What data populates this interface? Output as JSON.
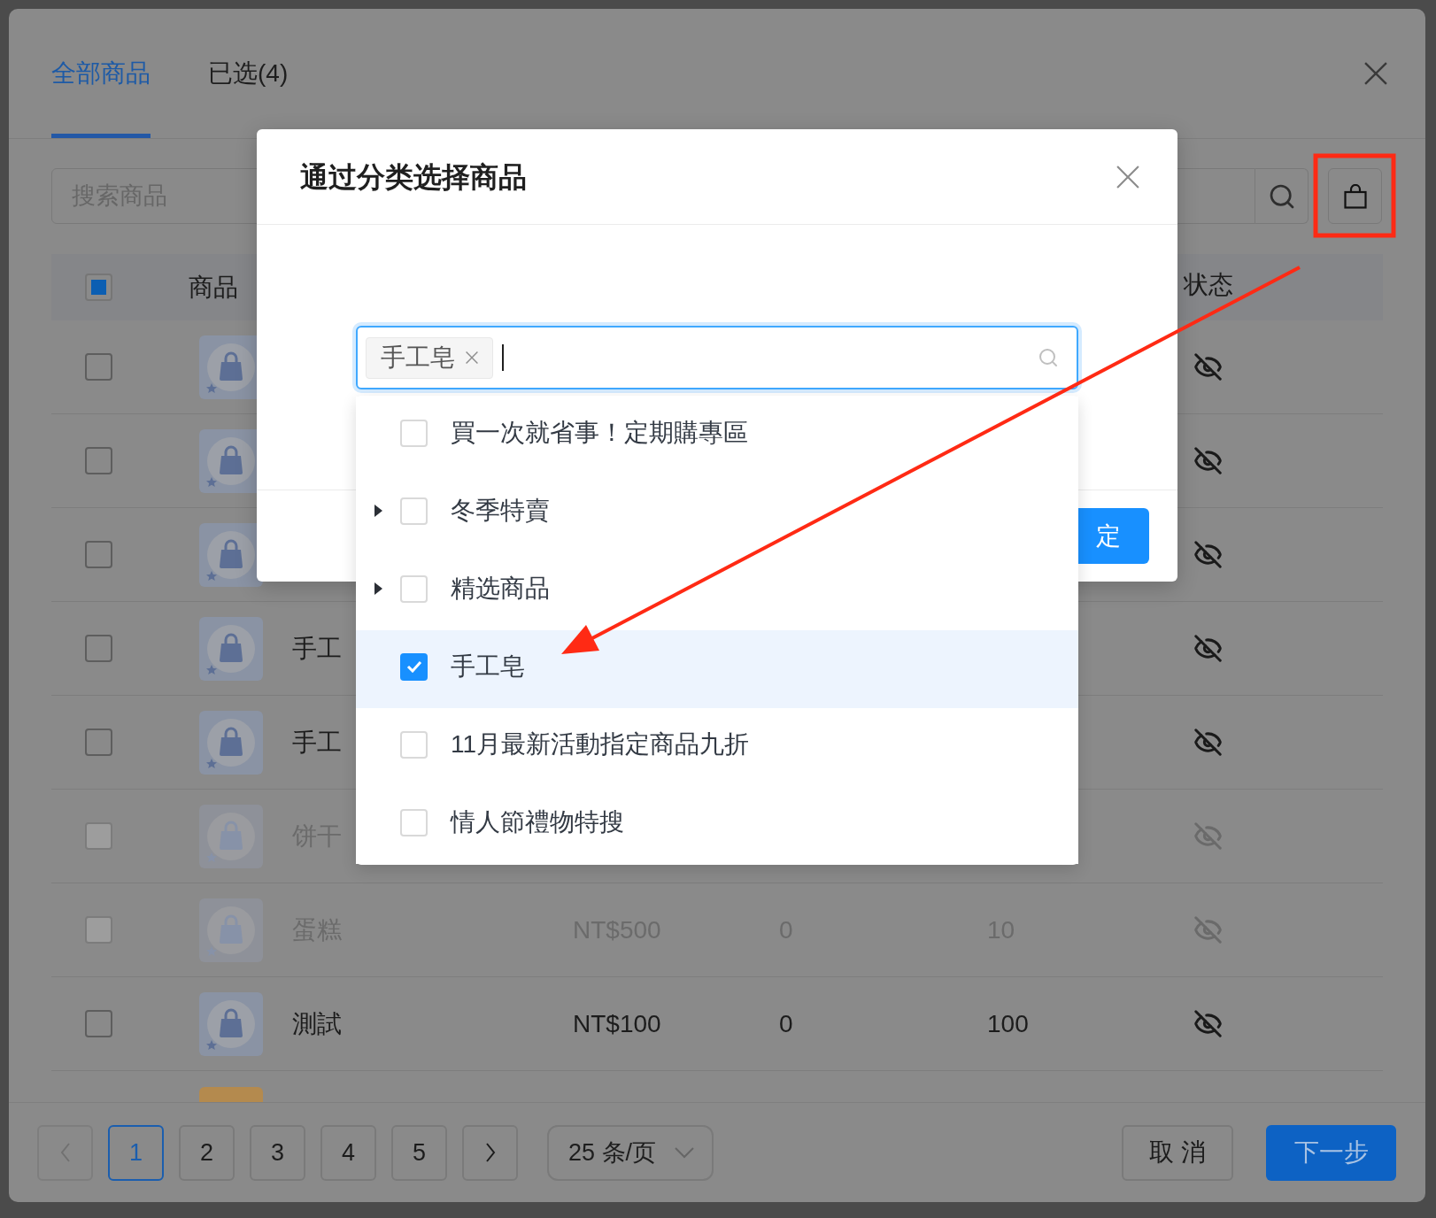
{
  "main_modal": {
    "tabs": [
      {
        "label": "全部商品",
        "selected": true
      },
      {
        "label": "已选(4)",
        "selected": false
      }
    ],
    "search": {
      "placeholder": "搜索商品"
    },
    "table": {
      "select_all": {
        "indeterminate": true
      },
      "columns": {
        "product": "商品",
        "status": "状态"
      },
      "rows": [
        {
          "kind": "bag",
          "checked": false,
          "disabled": false,
          "visible": false
        },
        {
          "kind": "bag",
          "checked": false,
          "disabled": false,
          "visible": false
        },
        {
          "kind": "bag",
          "checked": false,
          "disabled": false,
          "visible": false
        },
        {
          "kind": "bag",
          "checked": false,
          "disabled": false,
          "name": "手工",
          "visible": false
        },
        {
          "kind": "bag",
          "checked": false,
          "disabled": false,
          "name": "手工",
          "visible": false
        },
        {
          "kind": "bag",
          "checked": false,
          "disabled": true,
          "name": "饼干",
          "visible": false
        },
        {
          "kind": "bag",
          "checked": false,
          "disabled": true,
          "name": "蛋糕",
          "cells": [
            "NT$500",
            "0",
            "10"
          ],
          "visible": false
        },
        {
          "kind": "bag",
          "checked": false,
          "disabled": false,
          "name": "測試",
          "cells": [
            "NT$100",
            "0",
            "100"
          ],
          "visible": false
        },
        {
          "kind": "photo"
        }
      ]
    },
    "pagination": {
      "prev": {
        "disabled": true
      },
      "pages": [
        {
          "label": "1",
          "selected": true
        },
        {
          "label": "2",
          "selected": false
        },
        {
          "label": "3",
          "selected": false
        },
        {
          "label": "4",
          "selected": false
        },
        {
          "label": "5",
          "selected": false
        }
      ],
      "next": {
        "disabled": false
      },
      "page_size": "25 条/页"
    },
    "buttons": {
      "cancel": "取 消",
      "next_step": "下一步"
    }
  },
  "category_dialog": {
    "title": "通过分类选择商品",
    "select": {
      "focused": true,
      "tags": [
        "手工皂"
      ]
    },
    "options": [
      {
        "kind": "leaf",
        "label": "買一次就省事！定期購專區",
        "checked": false,
        "selected": false
      },
      {
        "kind": "group",
        "expanded": false,
        "label": "冬季特賣",
        "checked": false,
        "selected": false
      },
      {
        "kind": "group",
        "expanded": false,
        "label": "精选商品",
        "checked": false,
        "selected": false
      },
      {
        "kind": "leaf",
        "label": "手工皂",
        "checked": true,
        "selected": true
      },
      {
        "kind": "leaf",
        "label": "11月最新活動指定商品九折",
        "checked": false,
        "selected": false
      },
      {
        "kind": "leaf",
        "label": "情人節禮物特搜",
        "checked": false,
        "selected": false
      }
    ],
    "confirm_button": "定"
  }
}
